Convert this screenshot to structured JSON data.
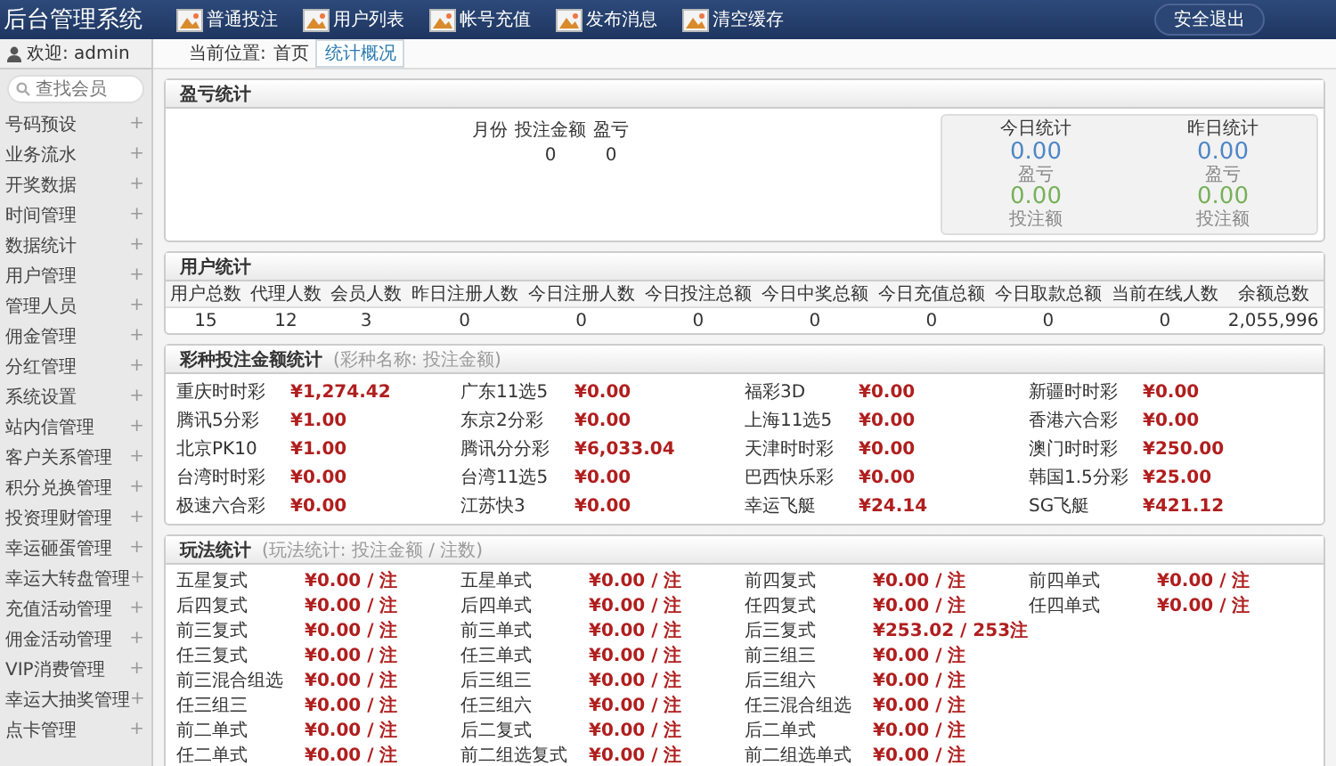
{
  "app_title": "后台管理系统",
  "nav": [
    {
      "label": "普通投注"
    },
    {
      "label": "用户列表"
    },
    {
      "label": "帐号充值"
    },
    {
      "label": "发布消息"
    },
    {
      "label": "清空缓存"
    }
  ],
  "logout_button": "安全退出",
  "user": {
    "greeting": "欢迎: admin"
  },
  "search": {
    "placeholder": "查找会员"
  },
  "sidebar": {
    "items": [
      {
        "label": "号码预设",
        "toggle": "+"
      },
      {
        "label": "业务流水",
        "toggle": "+"
      },
      {
        "label": "开奖数据",
        "toggle": "+"
      },
      {
        "label": "时间管理",
        "toggle": "+"
      },
      {
        "label": "数据统计",
        "toggle": "+"
      },
      {
        "label": "用户管理",
        "toggle": "+"
      },
      {
        "label": "管理人员",
        "toggle": "+"
      },
      {
        "label": "佣金管理",
        "toggle": "+"
      },
      {
        "label": "分红管理",
        "toggle": "+"
      },
      {
        "label": "系统设置",
        "toggle": "+"
      },
      {
        "label": "站内信管理",
        "toggle": "+"
      },
      {
        "label": "客户关系管理",
        "toggle": "+"
      },
      {
        "label": "积分兑换管理",
        "toggle": "+"
      },
      {
        "label": "投资理财管理",
        "toggle": "+"
      },
      {
        "label": "幸运砸蛋管理",
        "toggle": "+"
      },
      {
        "label": "幸运大转盘管理",
        "toggle": "+"
      },
      {
        "label": "充值活动管理",
        "toggle": "+"
      },
      {
        "label": "佣金活动管理",
        "toggle": "+"
      },
      {
        "label": "VIP消费管理",
        "toggle": "+"
      },
      {
        "label": "幸运大抽奖管理",
        "toggle": "+"
      },
      {
        "label": "点卡管理",
        "toggle": "+"
      }
    ]
  },
  "breadcrumb": {
    "label": "当前位置:",
    "home": "首页",
    "tabs": [
      {
        "label": "统计概况",
        "selected": true
      }
    ]
  },
  "profit_panel": {
    "title": "盈亏统计",
    "columns": [
      "月份",
      "投注金额",
      "盈亏"
    ],
    "rows": [
      {
        "bet": "0",
        "profit": "0"
      }
    ],
    "summary": [
      {
        "heading": "今日统计",
        "profit": "0.00",
        "profit_label": "盈亏",
        "bet": "0.00",
        "bet_label": "投注额"
      },
      {
        "heading": "昨日统计",
        "profit": "0.00",
        "profit_label": "盈亏",
        "bet": "0.00",
        "bet_label": "投注额"
      }
    ]
  },
  "user_stats": {
    "title": "用户统计",
    "columns": [
      "用户总数",
      "代理人数",
      "会员人数",
      "昨日注册人数",
      "今日注册人数",
      "今日投注总额",
      "今日中奖总额",
      "今日充值总额",
      "今日取款总额",
      "当前在线人数",
      "余额总数"
    ],
    "values": [
      "15",
      "12",
      "3",
      "0",
      "0",
      "0",
      "0",
      "0",
      "0",
      "0",
      "2,055,996"
    ]
  },
  "lottery_stats": {
    "title": "彩种投注金额统计",
    "subtitle": "(彩种名称: 投注金额)",
    "items": [
      {
        "name": "重庆时时彩",
        "amount": "¥1,274.42"
      },
      {
        "name": "广东11选5",
        "amount": "¥0.00"
      },
      {
        "name": "福彩3D",
        "amount": "¥0.00"
      },
      {
        "name": "新疆时时彩",
        "amount": "¥0.00"
      },
      {
        "name": "腾讯5分彩",
        "amount": "¥1.00"
      },
      {
        "name": "东京2分彩",
        "amount": "¥0.00"
      },
      {
        "name": "上海11选5",
        "amount": "¥0.00"
      },
      {
        "name": "香港六合彩",
        "amount": "¥0.00"
      },
      {
        "name": "北京PK10",
        "amount": "¥1.00"
      },
      {
        "name": "腾讯分分彩",
        "amount": "¥6,033.04"
      },
      {
        "name": "天津时时彩",
        "amount": "¥0.00"
      },
      {
        "name": "澳门时时彩",
        "amount": "¥250.00"
      },
      {
        "name": "台湾时时彩",
        "amount": "¥0.00"
      },
      {
        "name": "台湾11选5",
        "amount": "¥0.00"
      },
      {
        "name": "巴西快乐彩",
        "amount": "¥0.00"
      },
      {
        "name": "韩国1.5分彩",
        "amount": "¥25.00"
      },
      {
        "name": "极速六合彩",
        "amount": "¥0.00"
      },
      {
        "name": "江苏快3",
        "amount": "¥0.00"
      },
      {
        "name": "幸运飞艇",
        "amount": "¥24.14"
      },
      {
        "name": "SG飞艇",
        "amount": "¥421.12"
      }
    ]
  },
  "play_stats": {
    "title": "玩法统计",
    "subtitle": "(玩法统计: 投注金额 / 注数)",
    "rows": [
      [
        {
          "name": "五星复式",
          "amount": "¥0.00 / 注"
        },
        {
          "name": "五星单式",
          "amount": "¥0.00 / 注"
        },
        {
          "name": "前四复式",
          "amount": "¥0.00 / 注"
        },
        {
          "name": "前四单式",
          "amount": "¥0.00 / 注"
        }
      ],
      [
        {
          "name": "后四复式",
          "amount": "¥0.00 / 注"
        },
        {
          "name": "后四单式",
          "amount": "¥0.00 / 注"
        },
        {
          "name": "任四复式",
          "amount": "¥0.00 / 注"
        },
        {
          "name": "任四单式",
          "amount": "¥0.00 / 注"
        }
      ],
      [
        {
          "name": "前三复式",
          "amount": "¥0.00 / 注"
        },
        {
          "name": "前三单式",
          "amount": "¥0.00 / 注"
        },
        {
          "name": "后三复式",
          "amount": "¥253.02 / 253注"
        }
      ],
      [
        {
          "name": "任三复式",
          "amount": "¥0.00 / 注"
        },
        {
          "name": "任三单式",
          "amount": "¥0.00 / 注"
        },
        {
          "name": "前三组三",
          "amount": "¥0.00 / 注"
        }
      ],
      [
        {
          "name": "前三混合组选",
          "amount": "¥0.00 / 注"
        },
        {
          "name": "后三组三",
          "amount": "¥0.00 / 注"
        },
        {
          "name": "后三组六",
          "amount": "¥0.00 / 注"
        }
      ],
      [
        {
          "name": "任三组三",
          "amount": "¥0.00 / 注"
        },
        {
          "name": "任三组六",
          "amount": "¥0.00 / 注"
        },
        {
          "name": "任三混合组选",
          "amount": "¥0.00 / 注"
        }
      ],
      [
        {
          "name": "前二单式",
          "amount": "¥0.00 / 注"
        },
        {
          "name": "后二复式",
          "amount": "¥0.00 / 注"
        },
        {
          "name": "后二单式",
          "amount": "¥0.00 / 注"
        }
      ],
      [
        {
          "name": "任二单式",
          "amount": "¥0.00 / 注"
        },
        {
          "name": "前二组选复式",
          "amount": "¥0.00 / 注"
        },
        {
          "name": "前二组选单式",
          "amount": "¥0.00 / 注"
        }
      ]
    ]
  }
}
